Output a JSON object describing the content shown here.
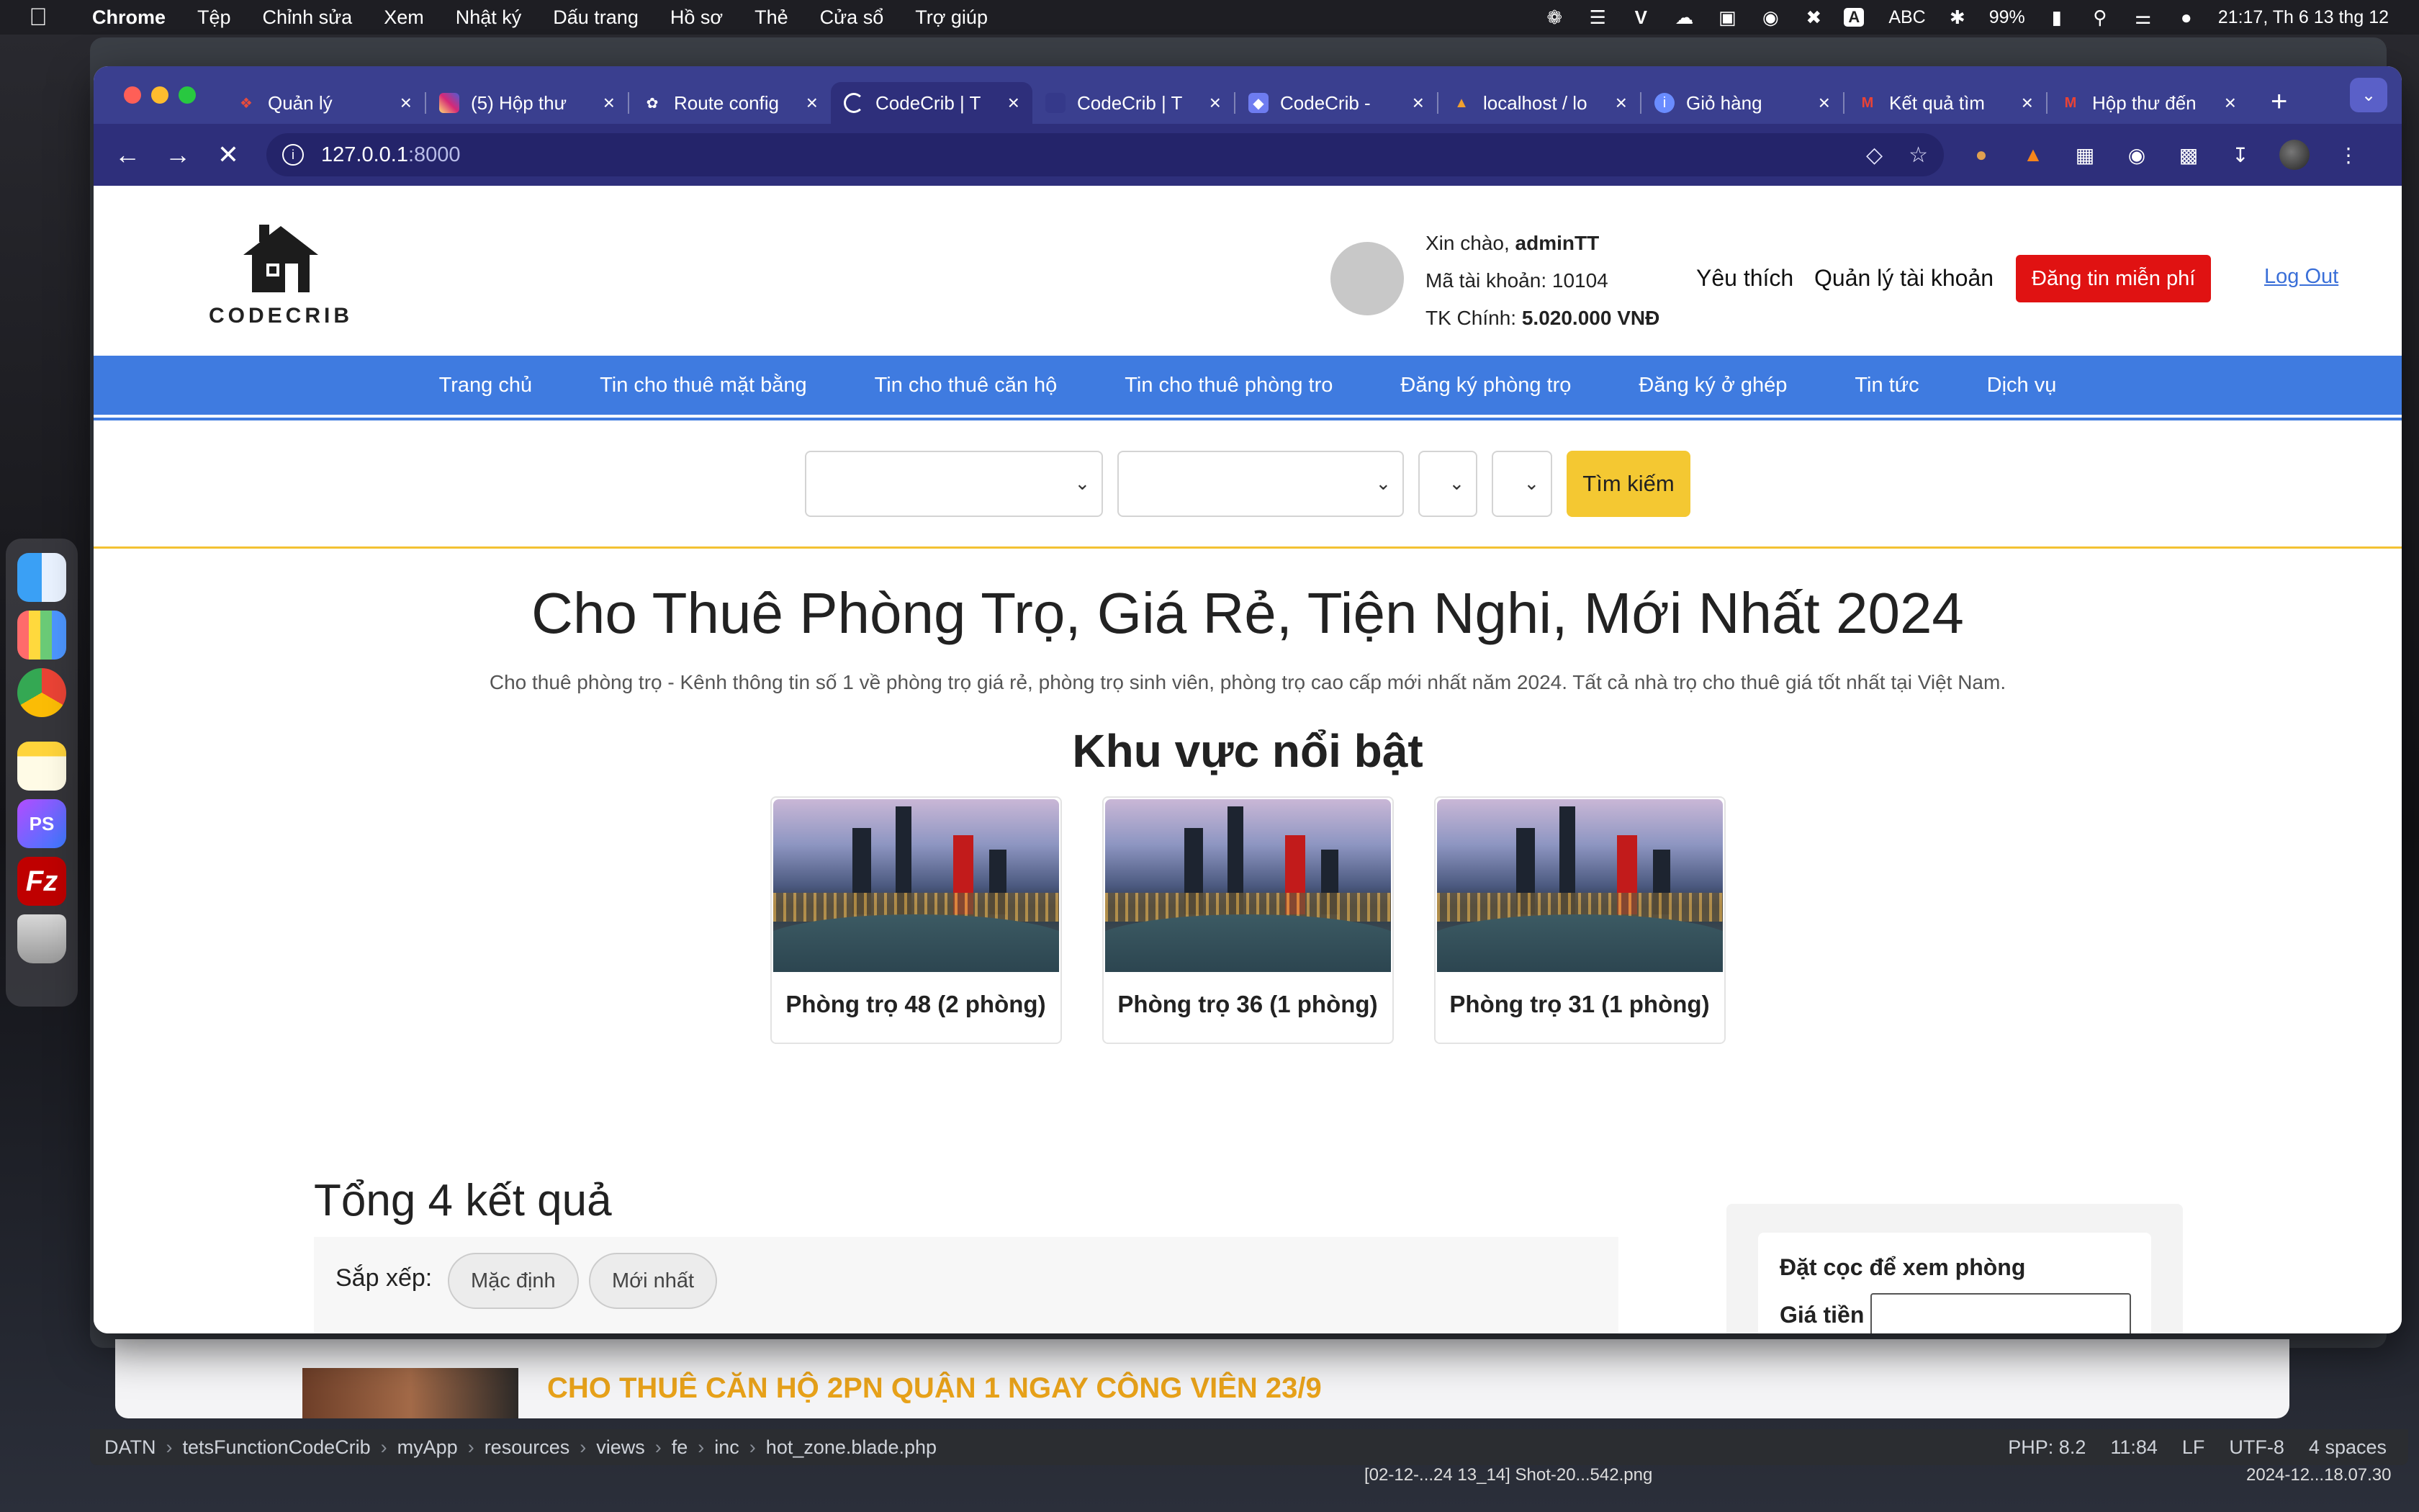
{
  "menubar": {
    "items": [
      "Chrome",
      "Tệp",
      "Chỉnh sửa",
      "Xem",
      "Nhật ký",
      "Dấu trang",
      "Hồ sơ",
      "Thẻ",
      "Cửa sổ",
      "Trợ giúp"
    ],
    "input_source": "ABC",
    "battery": "99%",
    "clock": "21:17, Th 6 13 thg 12",
    "input_badge": "A"
  },
  "browser": {
    "tabs": [
      {
        "title": "Quản lý",
        "fav": "laravel-icon",
        "color": "#e74c3c"
      },
      {
        "title": "(5) Hộp thư",
        "fav": "instagram-icon",
        "color": "#d62976"
      },
      {
        "title": "Route config",
        "fav": "openai-icon",
        "color": "#ffffff"
      },
      {
        "title": "CodeCrib | T",
        "fav": "loading-icon",
        "color": "#ffffff"
      },
      {
        "title": "CodeCrib | T",
        "fav": "page-icon",
        "color": "#3a3f8f"
      },
      {
        "title": "CodeCrib - ",
        "fav": "shield-icon",
        "color": "#6e7cf0"
      },
      {
        "title": "localhost / lo",
        "fav": "phpmyadmin-icon",
        "color": "#f0a030"
      },
      {
        "title": "Giỏ hàng",
        "fav": "info-icon",
        "color": "#6a8cff"
      },
      {
        "title": "Kết quả tìm",
        "fav": "gmail-icon",
        "color": "#ea4335"
      },
      {
        "title": "Hộp thư đến",
        "fav": "gmail-icon",
        "color": "#ea4335"
      }
    ],
    "url_host": "127.0.0.1",
    "url_port": ":8000"
  },
  "site": {
    "logo_text": "CODECRIB",
    "greeting_prefix": "Xin chào, ",
    "username": "adminTT",
    "account_id": "Mã tài khoản: 10104",
    "balance_label": "TK Chính: ",
    "balance_value": "5.020.000 VNĐ",
    "favorites": "Yêu thích",
    "account_manage": "Quản lý tài khoản",
    "post_free": "Đăng tin miễn phí",
    "logout": "Log Out",
    "nav": [
      "Trang chủ",
      "Tin cho thuê mặt bằng",
      "Tin cho thuê căn hộ",
      "Tin cho thuê phòng tro",
      "Đăng ký phòng trọ",
      "Đăng ký ở ghép",
      "Tin tức",
      "Dịch vụ"
    ],
    "search_button": "Tìm kiếm",
    "hero_title": "Cho Thuê Phòng Trọ, Giá Rẻ, Tiện Nghi, Mới Nhất 2024",
    "hero_subtitle": "Cho thuê phòng trọ - Kênh thông tin số 1 về phòng trọ giá rẻ, phòng trọ sinh viên, phòng trọ cao cấp mới nhất năm 2024. Tất cả nhà trọ cho thuê giá tốt nhất tại Việt Nam.",
    "zones_title": "Khu vực nổi bật",
    "zones": [
      {
        "label": "Phòng trọ 48 (2 phòng)"
      },
      {
        "label": "Phòng trọ 36 (1 phòng)"
      },
      {
        "label": "Phòng trọ 31 (1 phòng)"
      }
    ],
    "results_title": "Tổng 4 kết quả",
    "sort_label": "Sắp xếp:",
    "sort_default": "Mặc định",
    "sort_newest": "Mới nhất",
    "deposit_title": "Đặt cọc để xem phòng",
    "price_label": "Giá tiền"
  },
  "background": {
    "listing_title": "CHO THUÊ CĂN HỘ 2PN QUẬN 1 NGAY CÔNG VIÊN 23/9",
    "ide_breadcrumb": [
      "DATN",
      "tetsFunctionCodeCrib",
      "myApp",
      "resources",
      "views",
      "fe",
      "inc",
      "hot_zone.blade.php"
    ],
    "ide_status": [
      "PHP: 8.2",
      "11:84",
      "LF",
      "UTF-8",
      "4 spaces"
    ],
    "download_1": "[02-12-...24 13_14]   Shot-20...542.png",
    "download_2": "2024-12...18.07.30"
  }
}
